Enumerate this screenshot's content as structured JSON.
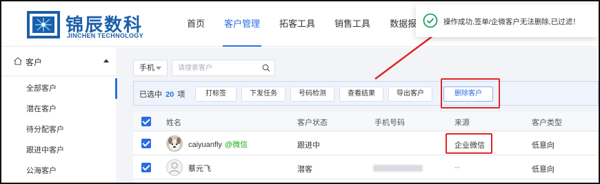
{
  "brand": {
    "name_cn": "锦辰数科",
    "name_en": "JINCHEN TECHNOLOGY",
    "color": "#1b5fa8"
  },
  "nav": {
    "items": [
      {
        "label": "首页"
      },
      {
        "label": "客户管理"
      },
      {
        "label": "拓客工具"
      },
      {
        "label": "销售工具"
      },
      {
        "label": "数据报表"
      }
    ],
    "active_index": 1
  },
  "toast": {
    "text": "操作成功,签单/企微客户无法删除,已过滤！",
    "icon": "check-circle-icon",
    "color": "#19a15f"
  },
  "sidebar": {
    "section": {
      "label": "客户",
      "icon": "home-icon"
    },
    "items": [
      {
        "label": "全部客户"
      },
      {
        "label": "潜在客户"
      },
      {
        "label": "待分配客户"
      },
      {
        "label": "跟进中客户"
      },
      {
        "label": "公海客户"
      }
    ]
  },
  "search": {
    "type_selected": "手机",
    "placeholder": "请搜索客户"
  },
  "action_bar": {
    "selected_prefix": "已选中",
    "selected_count": "20",
    "selected_suffix": "项",
    "buttons": {
      "tag": "打标签",
      "assign": "下发任务",
      "detect": "号码检测",
      "result": "查看结果",
      "export": "导出客户",
      "delete": "删除客户"
    }
  },
  "table": {
    "headers": {
      "name": "姓名",
      "status": "客户状态",
      "phone": "手机号码",
      "source": "来源",
      "type": "客户类型"
    },
    "rows": [
      {
        "name": "caiyuanfly",
        "tag": "@微信",
        "status": "跟进中",
        "phone": "",
        "source": "企业微信",
        "type": "低意向"
      },
      {
        "name": "蔡元飞",
        "tag": "",
        "status": "潜客",
        "phone": "",
        "source": "--",
        "type": "低意向"
      }
    ]
  },
  "colors": {
    "primary": "#2b6de1",
    "highlight_red": "#e02424",
    "wechat_green": "#1aad19"
  }
}
